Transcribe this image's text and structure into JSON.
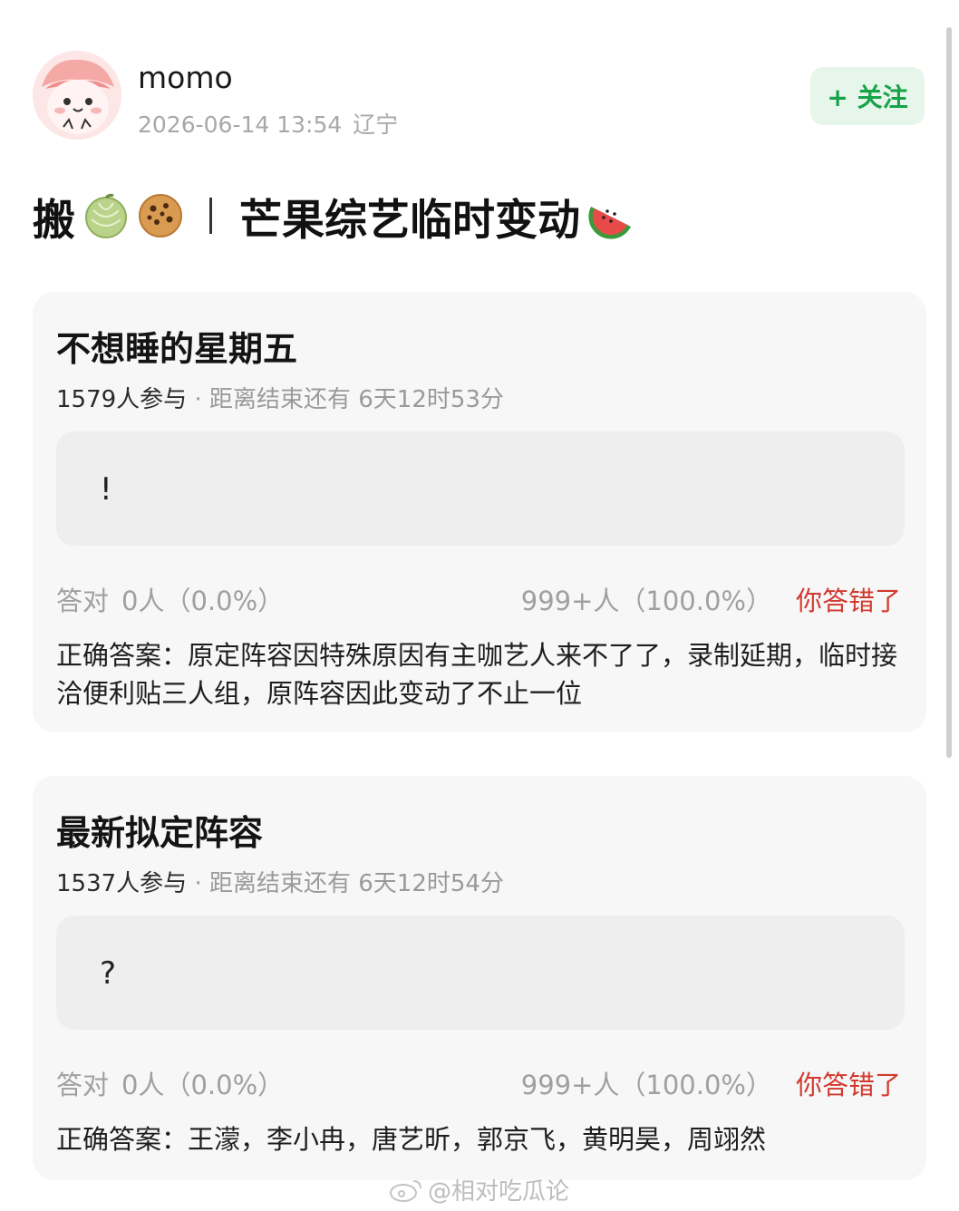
{
  "user": {
    "name": "momo",
    "datetime": "2026-06-14 13:54",
    "location": "辽宁"
  },
  "follow_label": "+ 关注",
  "post": {
    "title_prefix": "搬",
    "title_main": "芒果综艺临时变动",
    "emoji_icons": [
      "melon-icon",
      "cookie-icon",
      "watermelon-icon"
    ]
  },
  "quizzes": [
    {
      "title": "不想睡的星期五",
      "participants": "1579人参与",
      "countdown": "· 距离结束还有 6天12时53分",
      "answer_text": "!",
      "correct_label": "答对",
      "correct_stat": "0人（0.0%）",
      "wrong_stat": "999+人（100.0%）",
      "result": "你答错了",
      "solution": "正确答案：原定阵容因特殊原因有主咖艺人来不了了，录制延期，临时接洽便利贴三人组，原阵容因此变动了不止一位"
    },
    {
      "title": "最新拟定阵容",
      "participants": "1537人参与",
      "countdown": "· 距离结束还有 6天12时54分",
      "answer_text": "?",
      "correct_label": "答对",
      "correct_stat": "0人（0.0%）",
      "wrong_stat": "999+人（100.0%）",
      "result": "你答错了",
      "solution": "正确答案：王濛，李小冉，唐艺昕，郭京飞，黄明昊，周翊然"
    }
  ],
  "watermark": "@相对吃瓜论",
  "colors": {
    "follow_bg": "#e7f6ea",
    "follow_text": "#17a34a",
    "wrong": "#d23a2f"
  }
}
